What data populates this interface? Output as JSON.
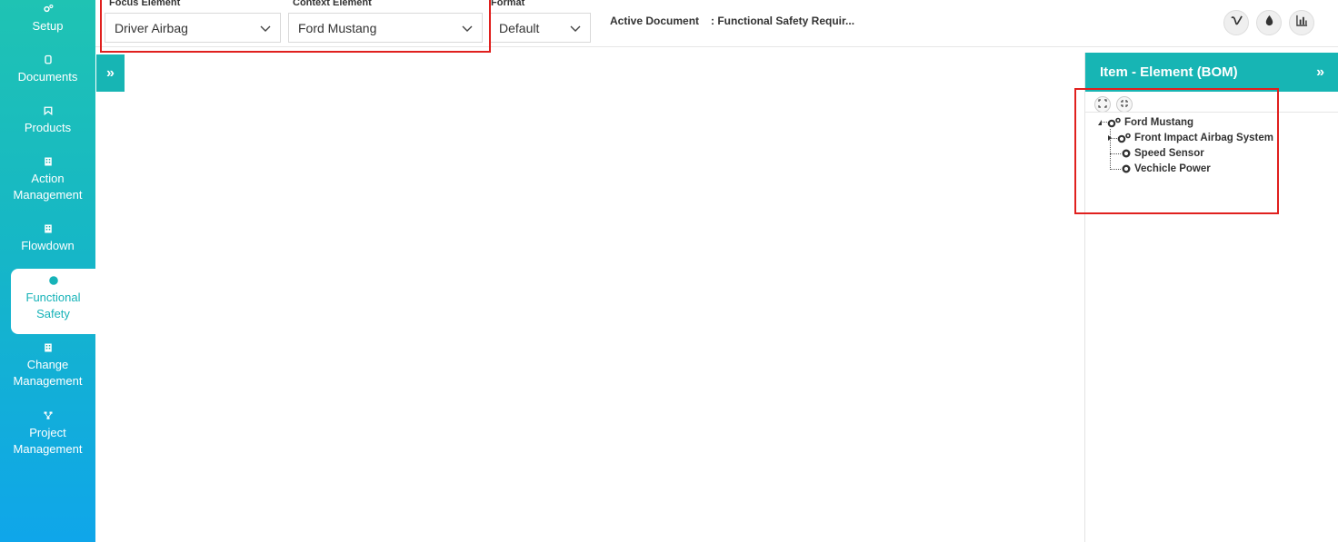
{
  "sidebar": {
    "items": [
      {
        "id": "setup",
        "label": "Setup",
        "icon": "gears-icon"
      },
      {
        "id": "documents",
        "label": "Documents",
        "icon": "copy-icon"
      },
      {
        "id": "products",
        "label": "Products",
        "icon": "product-icon"
      },
      {
        "id": "action-management",
        "label": "Action Management",
        "icon": "building-icon"
      },
      {
        "id": "flowdown",
        "label": "Flowdown",
        "icon": "building-icon"
      },
      {
        "id": "functional-safety",
        "label": "Functional Safety",
        "icon": "safety-icon",
        "active": true
      },
      {
        "id": "change-management",
        "label": "Change Management",
        "icon": "building-icon"
      },
      {
        "id": "project-management",
        "label": "Project Management",
        "icon": "hierarchy-icon"
      }
    ]
  },
  "toolbar": {
    "focus_label": "Focus Element",
    "focus_value": "Driver Airbag",
    "context_label": "Context Element",
    "context_value": "Ford Mustang",
    "format_label": "Format",
    "format_value": "Default",
    "active_doc_label": "Active Document",
    "active_doc_value": ": Functional Safety Requir...",
    "actions": [
      {
        "icon": "vimeo-icon"
      },
      {
        "icon": "droplet-icon"
      },
      {
        "icon": "bar-chart-icon"
      }
    ]
  },
  "right_panel": {
    "title": "Item - Element (BOM)",
    "tree": {
      "root": "Ford Mustang",
      "children": [
        "Front Impact Airbag System",
        "Speed Sensor",
        "Vechicle Power"
      ]
    }
  },
  "colors": {
    "accent": "#17b5b4",
    "sidebar_bottom": "#0fa6ea",
    "highlight": "#e0201e"
  }
}
